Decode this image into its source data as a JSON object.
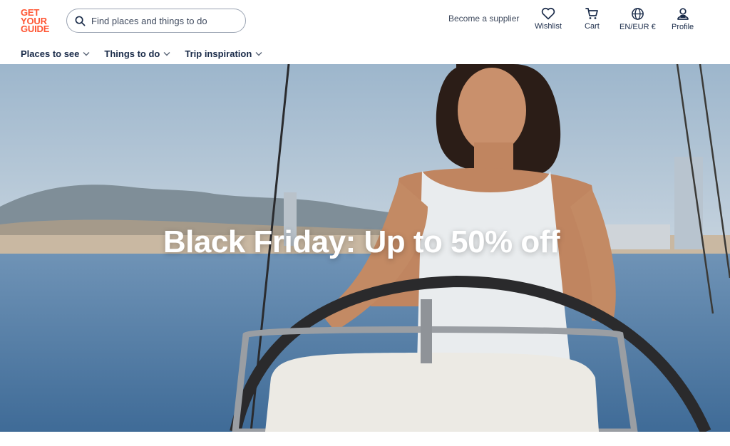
{
  "brand": {
    "logo_lines": [
      "GET",
      "YOUR",
      "GUIDE"
    ],
    "color": "#ff5533"
  },
  "search": {
    "placeholder": "Find places and things to do"
  },
  "header": {
    "supplier_link": "Become a supplier",
    "actions": [
      {
        "label": "Wishlist",
        "icon": "heart-icon"
      },
      {
        "label": "Cart",
        "icon": "cart-icon"
      },
      {
        "label": "EN/EUR €",
        "icon": "globe-icon"
      },
      {
        "label": "Profile",
        "icon": "profile-icon"
      }
    ]
  },
  "subnav": {
    "items": [
      {
        "label": "Places to see"
      },
      {
        "label": "Things to do"
      },
      {
        "label": "Trip inspiration"
      }
    ]
  },
  "hero": {
    "title": "Black Friday: Up to 50% off"
  },
  "colors": {
    "text": "#1a2b49",
    "accent": "#ff5533",
    "sky": "#a9bfd3",
    "sea": "#4d7aa3"
  }
}
